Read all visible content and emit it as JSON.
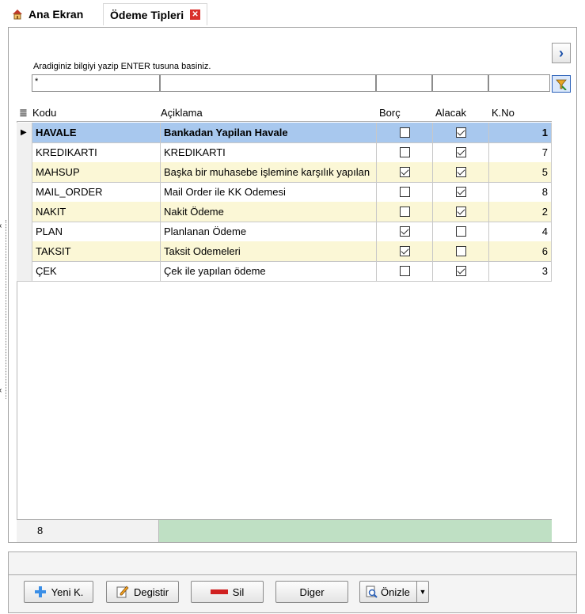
{
  "tabs": [
    {
      "label": "Ana Ekran",
      "icon": "home-icon"
    },
    {
      "label": "Ödeme Tipleri",
      "icon": "close-icon"
    }
  ],
  "filter": {
    "hint": "Aradiginiz bilgiyi yazip ENTER tusuna basiniz.",
    "value": "*"
  },
  "grid": {
    "columns": [
      "Kodu",
      "Açiklama",
      "Borç",
      "Alacak",
      "K.No"
    ],
    "rows": [
      {
        "kodu": "HAVALE",
        "aciklama": "Bankadan Yapilan Havale",
        "borc": false,
        "alacak": true,
        "kno": "1",
        "selected": true
      },
      {
        "kodu": "KREDIKARTI",
        "aciklama": "KREDIKARTI",
        "borc": false,
        "alacak": true,
        "kno": "7"
      },
      {
        "kodu": "MAHSUP",
        "aciklama": "Başka bir muhasebe işlemine karşılık yapılan",
        "borc": true,
        "alacak": true,
        "kno": "5"
      },
      {
        "kodu": "MAIL_ORDER",
        "aciklama": "Mail Order ile KK Odemesi",
        "borc": false,
        "alacak": true,
        "kno": "8"
      },
      {
        "kodu": "NAKIT",
        "aciklama": "Nakit Ödeme",
        "borc": false,
        "alacak": true,
        "kno": "2"
      },
      {
        "kodu": "PLAN",
        "aciklama": "Planlanan Ödeme",
        "borc": true,
        "alacak": false,
        "kno": "4"
      },
      {
        "kodu": "TAKSIT",
        "aciklama": "Taksit Odemeleri",
        "borc": true,
        "alacak": false,
        "kno": "6"
      },
      {
        "kodu": "ÇEK",
        "aciklama": "Çek ile yapılan ödeme",
        "borc": false,
        "alacak": true,
        "kno": "3"
      }
    ],
    "record_count": "8"
  },
  "buttons": {
    "new": "Yeni K.",
    "edit": "Degistir",
    "delete": "Sil",
    "other": "Diger",
    "preview": "Önizle"
  },
  "colors": {
    "selected_row": "#a8c8ee",
    "alt_row": "#fbf7d6",
    "footer_green": "#bfe0c4"
  }
}
